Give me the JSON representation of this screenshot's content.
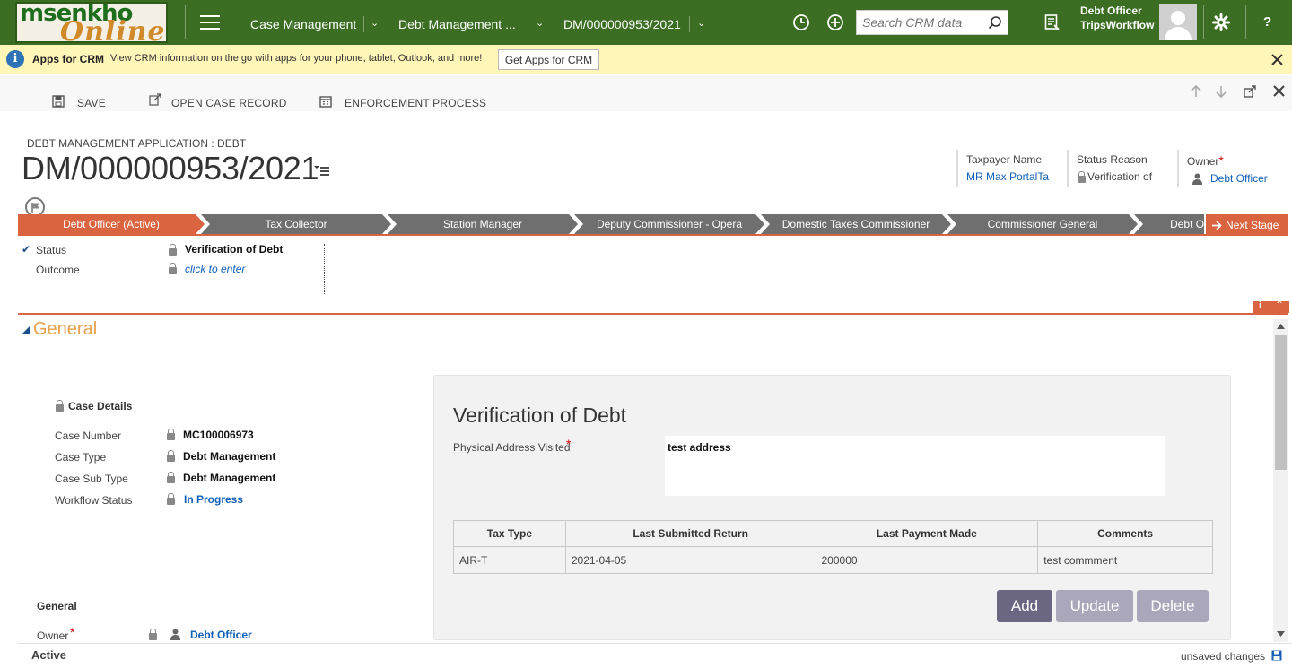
{
  "topnav": {
    "logo_line1": "msenkho",
    "logo_line2": "Online",
    "menu_icon": "hamburger-menu-icon",
    "nav_items": [
      "Case Management",
      "Debt Management ...",
      "DM/000000953/2021"
    ],
    "search_placeholder": "Search CRM data",
    "user_name": "Debt Officer",
    "user_org": "TripsWorkflow",
    "help": "?",
    "icons": [
      "history-icon",
      "new-record-icon",
      "search-icon",
      "advanced-find-icon",
      "settings-icon",
      "help-icon"
    ],
    "colors": {
      "background": "#3b6e22"
    }
  },
  "notification": {
    "title": "Apps for CRM",
    "message": "View CRM information on the go with apps for your phone, tablet, Outlook, and more!",
    "button": "Get Apps for CRM",
    "colors": {
      "background": "#fff6b8"
    }
  },
  "commandbar": {
    "save": "SAVE",
    "open_case": "OPEN CASE RECORD",
    "enforcement": "ENFORCEMENT PROCESS"
  },
  "header": {
    "entity_label": "DEBT MANAGEMENT APPLICATION : DEBT",
    "title": "DM/000000953/2021",
    "taxpayer_label": "Taxpayer Name",
    "taxpayer_value": "MR Max PortalTa",
    "status_reason_label": "Status Reason",
    "status_reason_value": "Verification of",
    "owner_label": "Owner",
    "owner_value": "Debt Officer",
    "required_marker": "*"
  },
  "process": {
    "stages": [
      "Debt Officer (Active)",
      "Tax Collector",
      "Station Manager",
      "Deputy Commissioner - Opera",
      "Domestic Taxes Commissioner",
      "Commissioner General",
      "Debt Office"
    ],
    "active_stage_index": 0,
    "next_stage": "Next Stage",
    "fields": [
      {
        "label": "Status",
        "value": "Verification of Debt",
        "check": "✔"
      },
      {
        "label": "Outcome",
        "value": "click to enter"
      }
    ],
    "colors": {
      "active": "#d9643f",
      "inactive": "#6f6f6f"
    }
  },
  "general": {
    "section_title": "General",
    "case_details_title": "Case Details",
    "case_details": [
      {
        "label": "Case Number",
        "value": "MC100006973"
      },
      {
        "label": "Case Type",
        "value": "Debt Management"
      },
      {
        "label": "Case Sub Type",
        "value": "Debt Management"
      },
      {
        "label": "Workflow Status",
        "value": "In Progress"
      }
    ],
    "general_subtitle": "General",
    "owner_label": "Owner",
    "owner_value": "Debt Officer"
  },
  "verification_panel": {
    "title": "Verification of Debt",
    "address_label": "Physical Address Visited",
    "address_value": "test address",
    "columns": [
      "Tax Type",
      "Last Submitted Return",
      "Last Payment Made",
      "Comments"
    ],
    "rows": [
      [
        "AIR-T",
        "2021-04-05",
        "200000",
        "test commment"
      ]
    ],
    "buttons": {
      "add": "Add",
      "update": "Update",
      "delete": "Delete"
    },
    "colors": {
      "add": "#6b6782",
      "disabled": "#a9a7b9"
    }
  },
  "statusbar": {
    "status": "Active",
    "unsaved": "unsaved changes"
  }
}
